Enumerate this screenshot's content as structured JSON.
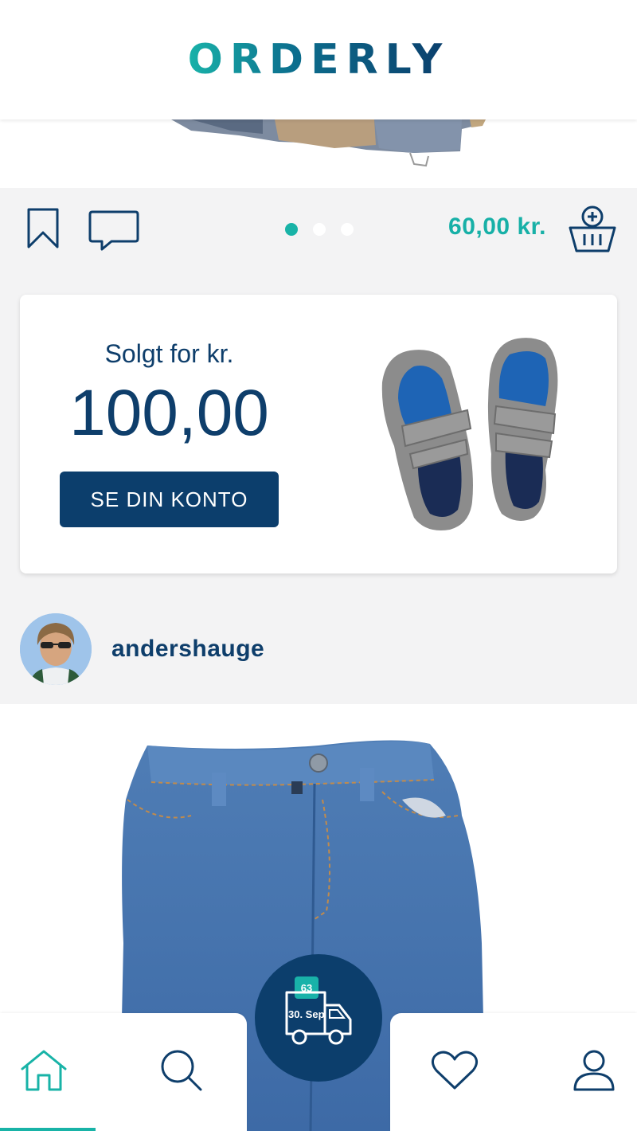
{
  "header": {
    "logo_text": "ORDERLY"
  },
  "actions": {
    "bookmark_icon": "bookmark-icon",
    "comment_icon": "comment-icon",
    "carousel_dots": 3,
    "carousel_active_index": 0,
    "price": "60,00 kr.",
    "basket_icon": "add-to-basket-icon"
  },
  "sold_card": {
    "label": "Solgt for kr.",
    "amount": "100,00",
    "button_label": "SE DIN KONTO"
  },
  "user": {
    "username": "andershauge"
  },
  "delivery": {
    "count": "63",
    "date": "30. Sep"
  },
  "nav": {
    "items": [
      "home-icon",
      "search-icon",
      "heart-icon",
      "profile-icon"
    ],
    "active": "home"
  },
  "colors": {
    "primary": "#0c3e6c",
    "accent": "#18b3a7",
    "background": "#f3f3f4"
  }
}
